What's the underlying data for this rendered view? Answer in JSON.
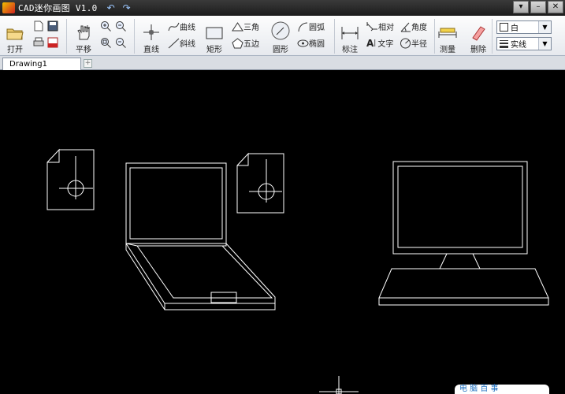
{
  "title_bar": {
    "app_title": "CAD迷你画图 V1.0",
    "undo_label": "↶",
    "redo_label": "↷",
    "window_buttons": [
      "▾",
      "–",
      "✕"
    ]
  },
  "toolbar": {
    "open": "打开",
    "pan": "平移",
    "line": "直线",
    "curve": "曲线",
    "slant_line": "斜线",
    "rect": "矩形",
    "triangle": "三角",
    "pentagon": "五边",
    "circle": "圆形",
    "arc": "圆弧",
    "ellipse": "椭圆",
    "dimension": "标注",
    "relative": "相对",
    "angle": "角度",
    "text": "文字",
    "radius": "半径",
    "measure": "测量",
    "delete": "删除"
  },
  "properties": {
    "color_value": "白",
    "linetype_value": "实线"
  },
  "tabs": [
    {
      "label": "Drawing1"
    }
  ],
  "watermark": "电 脑 百 事",
  "icons": {
    "open": "folder-icon",
    "new": "new-file-icon",
    "save": "save-icon",
    "print": "print-icon",
    "pdf": "pdf-icon",
    "pan": "pan-icon"
  }
}
